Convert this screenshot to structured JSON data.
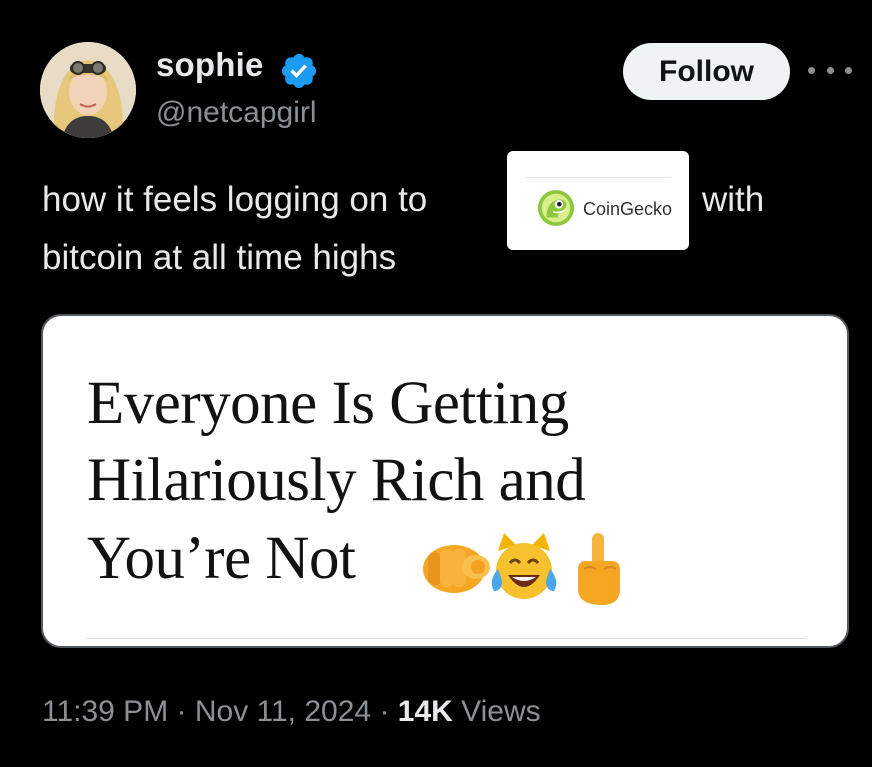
{
  "author": {
    "display_name": "sophie",
    "handle": "@netcapgirl",
    "verified_badge_icon": "verified-checkmark-icon",
    "badge_color": "#1d9bf0"
  },
  "actions": {
    "follow_label": "Follow",
    "more_icon": "more-horizontal-icon"
  },
  "tweet": {
    "text_line1_before": "how it feels logging on to",
    "text_line1_after": "with",
    "text_line2": "bitcoin at all time highs",
    "inline_logo_label": "CoinGecko",
    "inline_logo_icon": "coingecko-gecko-icon"
  },
  "media": {
    "headline_line1": "Everyone Is Getting",
    "headline_line2": "Hilariously Rich and",
    "headline_line3": "You’re Not",
    "emoji_icons": [
      "pointing-fist-emoji",
      "crying-laughing-cat-emoji",
      "middle-finger-emoji"
    ]
  },
  "meta": {
    "time": "11:39 PM",
    "sep1": " · ",
    "date": "Nov 11, 2024",
    "sep2": " · ",
    "views_count": "14K",
    "views_label": " Views"
  },
  "colors": {
    "background": "#000000",
    "primary_text": "#e7e9ea",
    "secondary_text": "#8b9095",
    "follow_bg": "#eff3f4",
    "coingecko_green": "#8dc63f"
  }
}
